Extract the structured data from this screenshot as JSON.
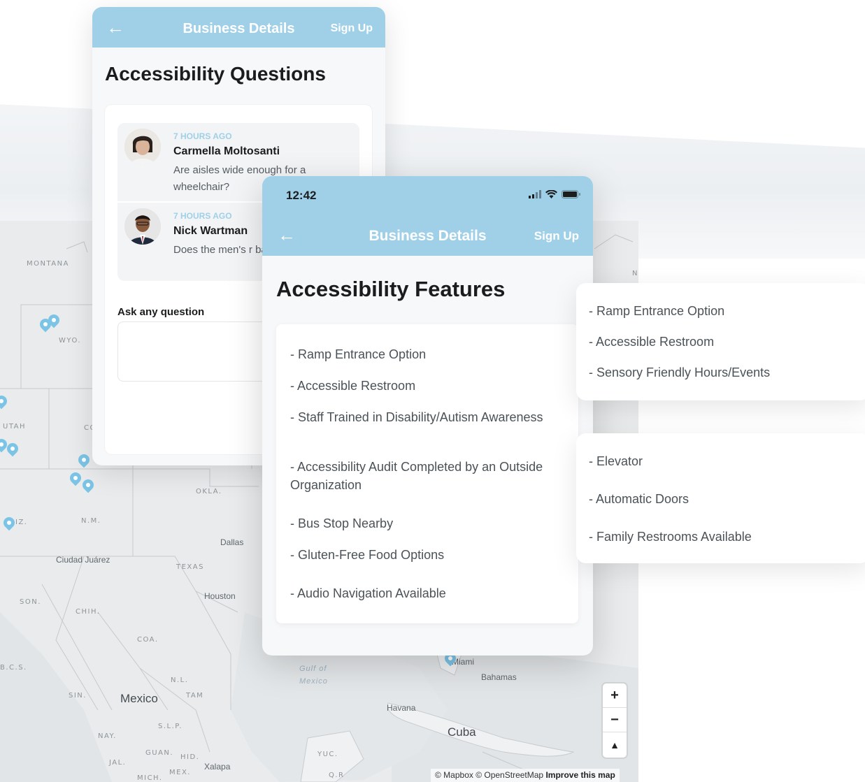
{
  "colors": {
    "accent": "#9fd0e8",
    "pin": "#7cc4e6",
    "time_label": "#9fd0e8"
  },
  "map": {
    "states": [
      "MONTANA",
      "WYO.",
      "UTAH",
      "CO",
      "OKLA.",
      "N.M.",
      "TEXAS",
      "IZ.",
      "SON.",
      "CHIH.",
      "COA.",
      "B.C.S.",
      "SIN.",
      "N.L.",
      "TAM",
      "S.L.P.",
      "NAY.",
      "JAL.",
      "GUAN.",
      "HID.",
      "MEX.",
      "MICH.",
      "YUC.",
      "Q.R",
      "N"
    ],
    "cities": [
      "Dallas",
      "Ciudad Juárez",
      "Houston",
      "Miami",
      "Bahamas",
      "Havana",
      "Xalapa"
    ],
    "countries": [
      "Mexico",
      "Cuba"
    ],
    "sea": [
      "Gulf of",
      "Mexico"
    ],
    "zoom_controls": {
      "zoom_in": "+",
      "zoom_out": "−",
      "compass": "▲"
    },
    "attribution": {
      "text": "© Mapbox © OpenStreetMap",
      "improve": "Improve this map"
    }
  },
  "questions_card": {
    "header": {
      "back_icon": "arrow-left-icon",
      "title": "Business Details",
      "signup": "Sign Up"
    },
    "heading": "Accessibility Questions",
    "questions": [
      {
        "time": "7 HOURS AGO",
        "name": "Carmella Moltosanti",
        "text": "Are aisles wide enough for a wheelchair?"
      },
      {
        "time": "7 HOURS AGO",
        "name": "Nick Wartman",
        "text": "Does the men's r baby changing ta"
      }
    ],
    "ask_label": "Ask any question"
  },
  "features_card": {
    "status_bar": {
      "time": "12:42",
      "icons": [
        "signal-icon",
        "wifi-icon",
        "battery-icon"
      ]
    },
    "header": {
      "back_icon": "arrow-left-icon",
      "title": "Business Details",
      "signup": "Sign Up"
    },
    "heading": "Accessibility Features",
    "features": [
      "- Ramp Entrance Option",
      "- Accessible Restroom",
      "- Staff Trained in Disability/Autism Awareness",
      "- Accessibility Audit Completed by an Outside Organization",
      "- Bus Stop Nearby",
      "- Gluten-Free Food Options",
      "- Audio Navigation Available"
    ]
  },
  "floating_card_1": {
    "items": [
      "- Ramp Entrance Option",
      "- Accessible Restroom",
      "- Sensory Friendly Hours/Events"
    ]
  },
  "floating_card_2": {
    "items": [
      "- Elevator",
      "- Automatic Doors",
      "- Family Restrooms Available"
    ]
  }
}
